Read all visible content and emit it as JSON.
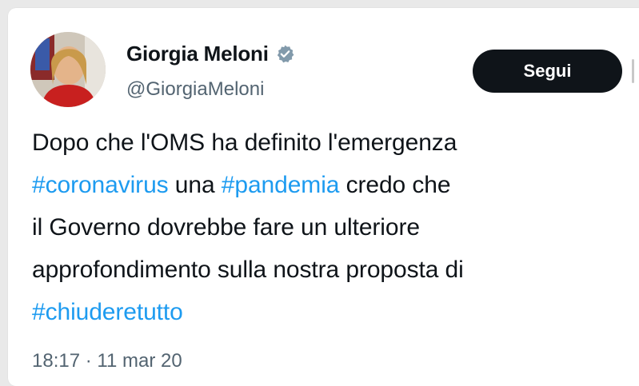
{
  "author": {
    "name": "Giorgia Meloni",
    "handle": "@GiorgiaMeloni",
    "verified": true
  },
  "follow_button": {
    "label": "Segui"
  },
  "tweet": {
    "lines": [
      [
        {
          "text": "Dopo che l'OMS ha definito l'emergenza",
          "hashtag": false
        }
      ],
      [
        {
          "text": "#coronavirus",
          "hashtag": true
        },
        {
          "text": " una ",
          "hashtag": false
        },
        {
          "text": "#pandemia",
          "hashtag": true
        },
        {
          "text": " credo che",
          "hashtag": false
        }
      ],
      [
        {
          "text": "il Governo dovrebbe fare un ulteriore",
          "hashtag": false
        }
      ],
      [
        {
          "text": "approfondimento sulla nostra proposta di",
          "hashtag": false
        }
      ],
      [
        {
          "text": "#chiuderetutto",
          "hashtag": true
        }
      ]
    ],
    "time": "18:17",
    "separator": "·",
    "date": "11 mar 20"
  },
  "colors": {
    "text": "#0f1419",
    "secondary": "#536471",
    "link": "#1d9bf0",
    "button_bg": "#0f1419"
  },
  "icons": {
    "verified": "verified-badge-icon"
  }
}
